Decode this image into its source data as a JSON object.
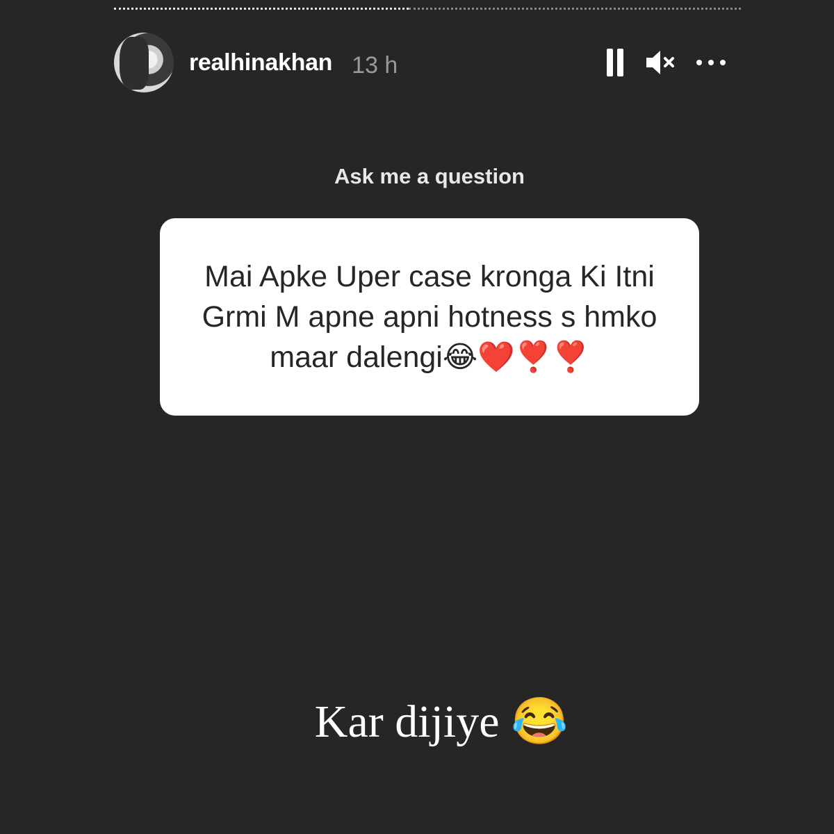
{
  "story": {
    "progress": 0.47,
    "colors": {
      "background": "#262626",
      "card": "#ffffff",
      "text_dark": "#262626",
      "muted": "#9a9a9a"
    }
  },
  "header": {
    "avatar_icon": "profile-photo",
    "username": "realhinakhan",
    "timestamp": "13 h",
    "controls": {
      "pause_icon": "pause-icon",
      "mute_icon": "muted-speaker-icon",
      "more_icon": "more-horizontal-icon"
    }
  },
  "question_sticker": {
    "title": "Ask me a question",
    "question": "Mai Apke Uper case kronga Ki Itni Grmi M apne apni hotness s hmko maar dalengi😂❤️❣️❣️"
  },
  "answer": {
    "text": "Kar dijiye 😂"
  }
}
